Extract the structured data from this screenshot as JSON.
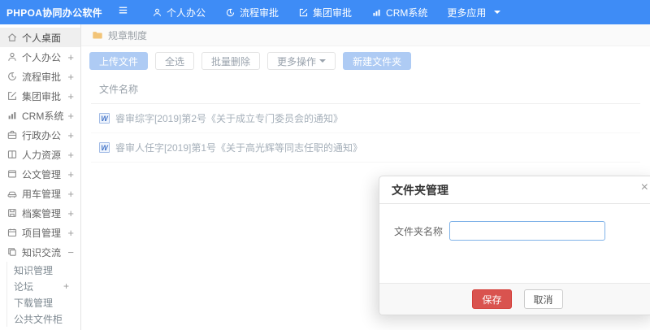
{
  "colors": {
    "navbar_bg": "#3e8cf6",
    "primary_button_bg": "#aecbf4",
    "danger_button_bg": "#d9534f",
    "folder_icon": "#f2c478",
    "input_focus_border": "#7fb2e8"
  },
  "navbar": {
    "brand": "PHPOA协同办公软件",
    "items": [
      {
        "label": "个人办公"
      },
      {
        "label": "流程审批"
      },
      {
        "label": "集团审批"
      },
      {
        "label": "CRM系统"
      },
      {
        "label": "更多应用"
      }
    ]
  },
  "sidebar": {
    "items": [
      {
        "label": "个人桌面",
        "expand": ""
      },
      {
        "label": "个人办公",
        "expand": "+"
      },
      {
        "label": "流程审批",
        "expand": "+"
      },
      {
        "label": "集团审批",
        "expand": "+"
      },
      {
        "label": "CRM系统",
        "expand": "+"
      },
      {
        "label": "行政办公",
        "expand": "+"
      },
      {
        "label": "人力资源",
        "expand": "+"
      },
      {
        "label": "公文管理",
        "expand": "+"
      },
      {
        "label": "用车管理",
        "expand": "+"
      },
      {
        "label": "档案管理",
        "expand": "+"
      },
      {
        "label": "项目管理",
        "expand": "+"
      },
      {
        "label": "知识交流",
        "expand": "−"
      }
    ],
    "sub_items": [
      {
        "label": "知识管理",
        "expand": ""
      },
      {
        "label": "论坛",
        "expand": "+"
      },
      {
        "label": "下载管理",
        "expand": ""
      },
      {
        "label": "公共文件柜",
        "expand": ""
      }
    ]
  },
  "breadcrumb": {
    "label": "规章制度"
  },
  "toolbar": {
    "upload": "上传文件",
    "select_all": "全选",
    "batch_delete": "批量删除",
    "more_actions": "更多操作",
    "new_folder": "新建文件夹"
  },
  "file_table": {
    "header": "文件名称",
    "file_icon": "W",
    "rows": [
      {
        "name": "睿审综字[2019]第2号《关于成立专门委员会的通知》"
      },
      {
        "name": "睿审人任字[2019]第1号《关于高光辉等同志任职的通知》"
      }
    ]
  },
  "modal": {
    "title": "文件夹管理",
    "close": "×",
    "field_label": "文件夹名称",
    "field_value": "",
    "save": "保存",
    "cancel": "取消"
  }
}
